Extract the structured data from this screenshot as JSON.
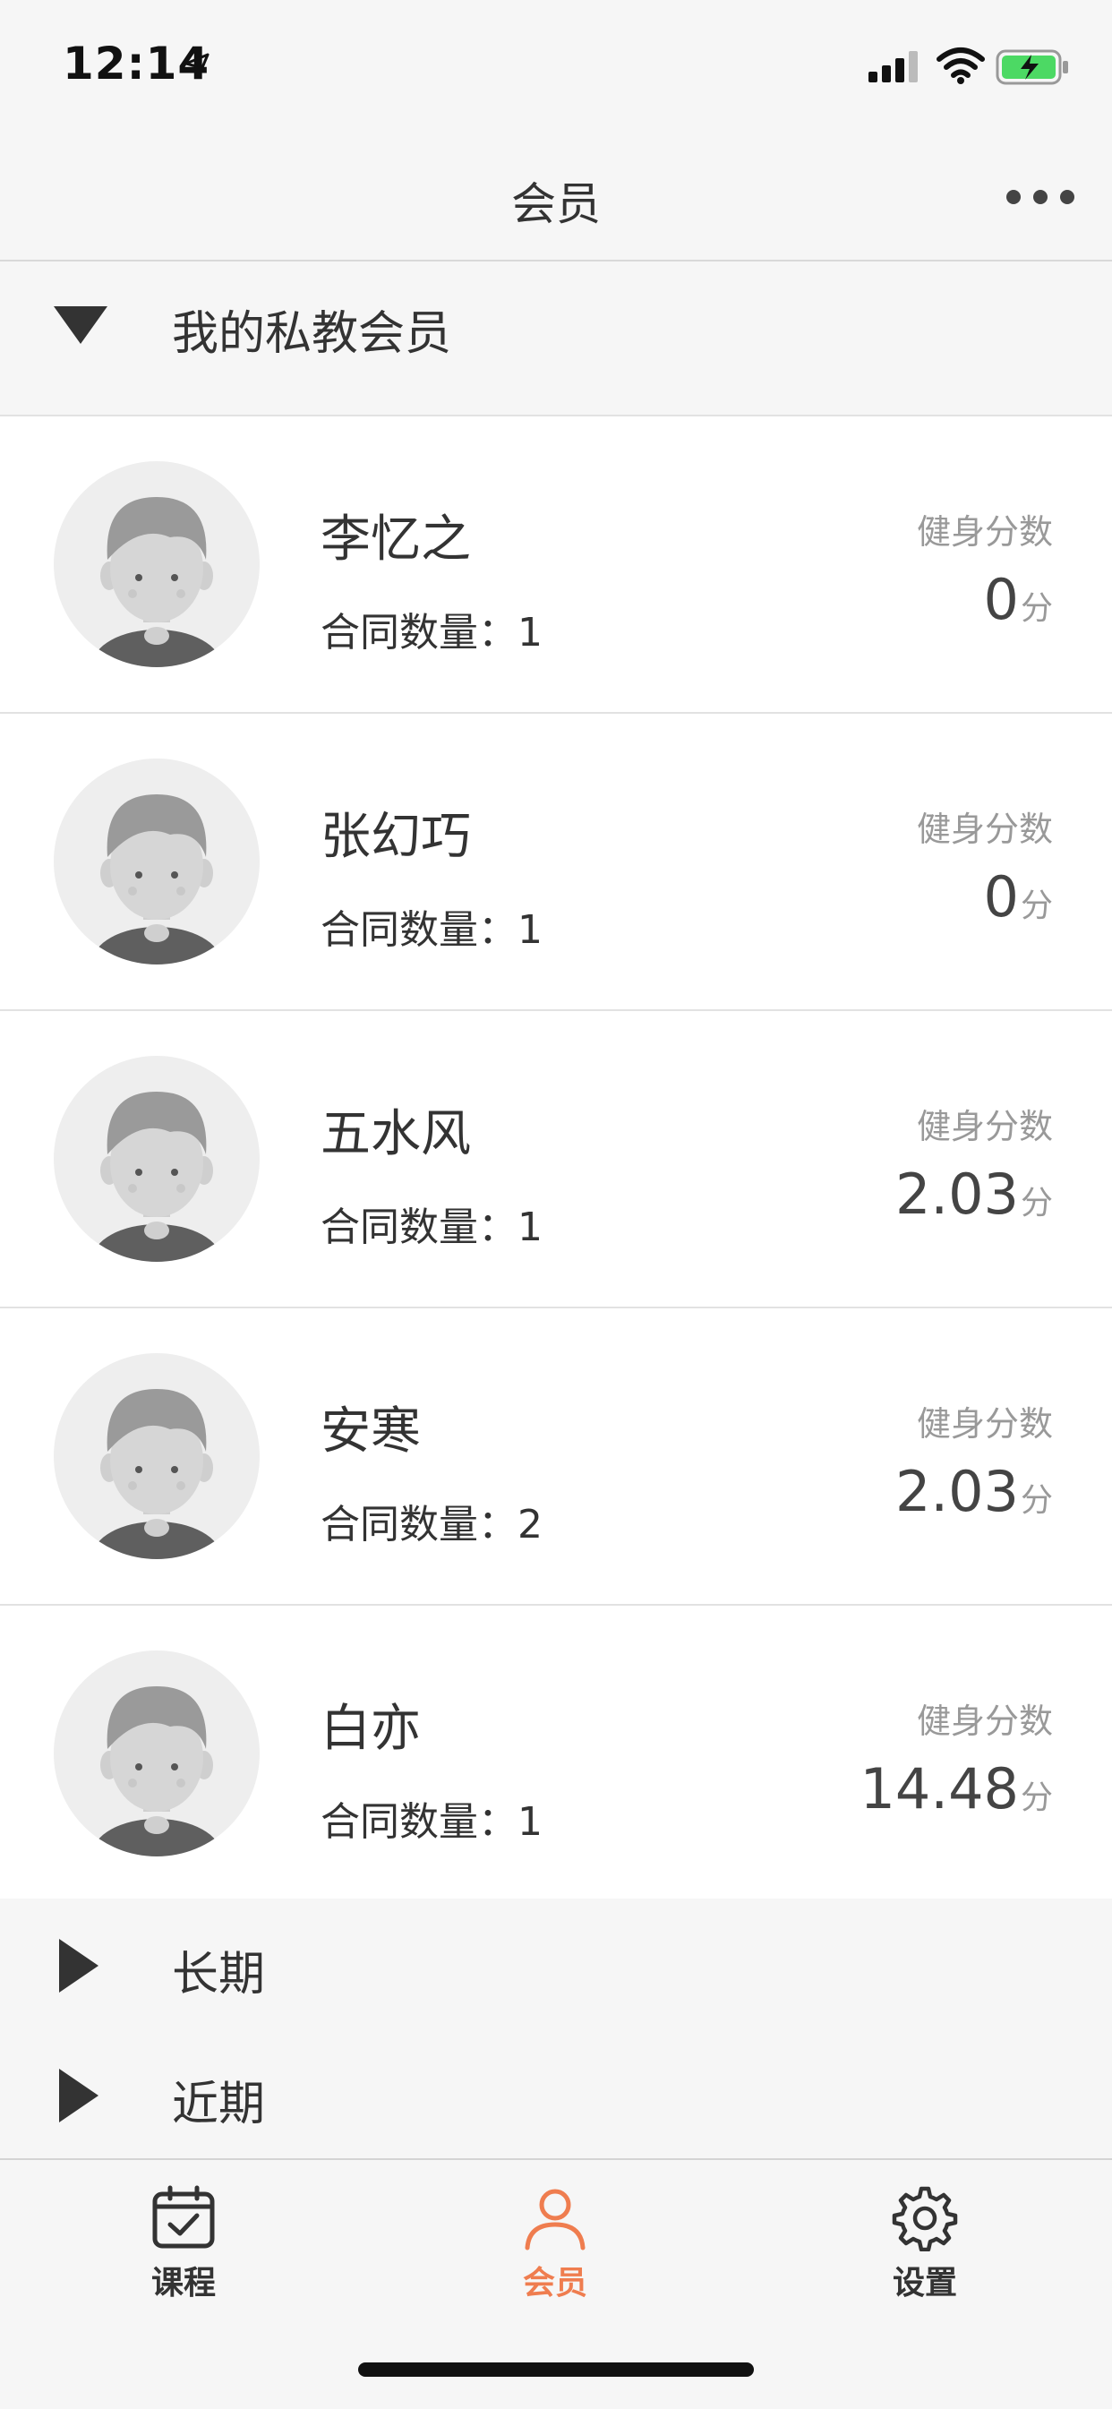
{
  "status_bar": {
    "time": "12:14"
  },
  "nav": {
    "title": "会员"
  },
  "groups": {
    "private": {
      "label": "我的私教会员"
    },
    "long_term": {
      "label": "长期"
    },
    "recent": {
      "label": "近期"
    }
  },
  "members": [
    {
      "name": "李忆之",
      "contract_label": "合同数量：",
      "contract_count": "1",
      "score_label": "健身分数",
      "score": "0",
      "score_unit": "分"
    },
    {
      "name": "张幻巧",
      "contract_label": "合同数量：",
      "contract_count": "1",
      "score_label": "健身分数",
      "score": "0",
      "score_unit": "分"
    },
    {
      "name": "五水风",
      "contract_label": "合同数量：",
      "contract_count": "1",
      "score_label": "健身分数",
      "score": "2.03",
      "score_unit": "分"
    },
    {
      "name": "安寒",
      "contract_label": "合同数量：",
      "contract_count": "2",
      "score_label": "健身分数",
      "score": "2.03",
      "score_unit": "分"
    },
    {
      "name": "白亦",
      "contract_label": "合同数量：",
      "contract_count": "1",
      "score_label": "健身分数",
      "score": "14.48",
      "score_unit": "分"
    }
  ],
  "tabs": [
    {
      "label": "课程",
      "icon": "calendar-check-icon",
      "active": false
    },
    {
      "label": "会员",
      "icon": "person-icon",
      "active": true
    },
    {
      "label": "设置",
      "icon": "gear-icon",
      "active": false
    }
  ],
  "colors": {
    "accent": "#ef7d4f",
    "text": "#333333",
    "muted": "#999999",
    "background": "#f6f6f6"
  }
}
